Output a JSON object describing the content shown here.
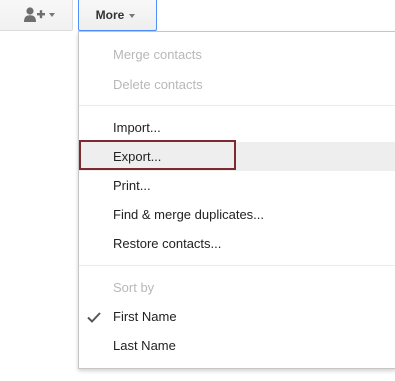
{
  "toolbar": {
    "add_contact_icon": "person-add-icon",
    "more_label": "More"
  },
  "menu": {
    "merge_contacts": "Merge contacts",
    "delete_contacts": "Delete contacts",
    "import": "Import...",
    "export": "Export...",
    "print": "Print...",
    "find_merge_duplicates": "Find & merge duplicates...",
    "restore_contacts": "Restore contacts...",
    "sort_by": "Sort by",
    "first_name": "First Name",
    "last_name": "Last Name",
    "selected_sort": "First Name",
    "highlighted_item": "Export..."
  },
  "colors": {
    "accent_border": "#4d90fe",
    "highlight_box": "#7b2b2f",
    "disabled_text": "#b8b8b8"
  }
}
